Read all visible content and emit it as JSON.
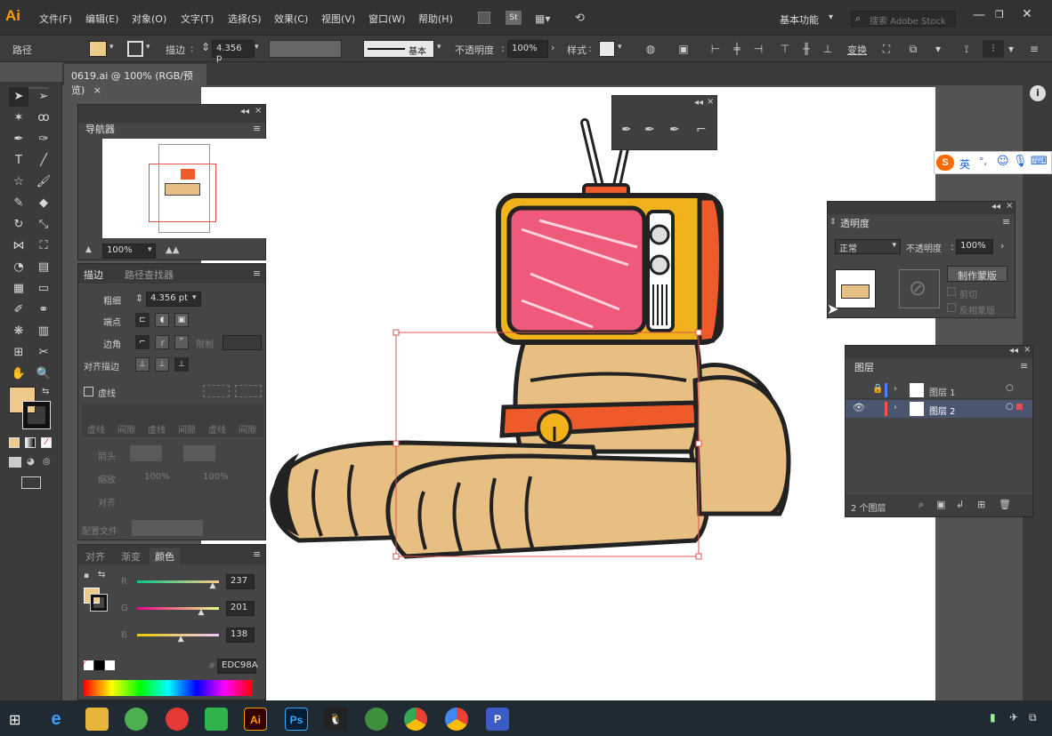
{
  "app": {
    "logo": "Ai",
    "menus": [
      "文件(F)",
      "编辑(E)",
      "对象(O)",
      "文字(T)",
      "选择(S)",
      "效果(C)",
      "视图(V)",
      "窗口(W)",
      "帮助(H)"
    ],
    "st_badge": "St",
    "workspace": "基本功能",
    "search_placeholder": "搜索 Adobe Stock"
  },
  "control_bar": {
    "path_label": "路径",
    "stroke_label": "描边",
    "stroke_value": "4.356 p",
    "profile_label": "基本",
    "opacity_label": "不透明度",
    "opacity_value": "100%",
    "style_label": "样式",
    "transform_label": "变换"
  },
  "document": {
    "tab_title": "0619.ai @ 100% (RGB/预览)",
    "close": "×"
  },
  "navigator": {
    "title": "导航器",
    "zoom": "100%"
  },
  "stroke_panel": {
    "tabs": [
      "描边",
      "路径查找器"
    ],
    "weight_label": "粗细",
    "weight_value": "4.356 pt",
    "cap_label": "端点",
    "corner_label": "边角",
    "limit_label": "限制",
    "align_label": "对齐描边",
    "dashed_label": "虚线",
    "dash_labels": [
      "虚线",
      "间隙",
      "虚线",
      "间隙",
      "虚线",
      "间隙"
    ],
    "arrow_label": "箭头",
    "scale_label": "缩放",
    "scale_a": "100%",
    "scale_b": "100%",
    "align_arrow_label": "对齐",
    "profile_label": "配置文件"
  },
  "color_panel": {
    "tabs": [
      "对齐",
      "渐变",
      "颜色"
    ],
    "r_label": "R",
    "g_label": "G",
    "b_label": "B",
    "r": 237,
    "g": 201,
    "b": 138,
    "hex_prefix": "#",
    "hex": "EDC98A",
    "fill_color": "#EDC98A"
  },
  "transparency_panel": {
    "title": "透明度",
    "blend_mode": "正常",
    "opacity_label": "不透明度",
    "opacity_value": "100%",
    "make_mask_label": "制作蒙版",
    "clip_label": "剪切",
    "invert_label": "反相蒙版"
  },
  "layers_panel": {
    "title": "图层",
    "layers": [
      {
        "name": "图层 1",
        "color": "#4f7fff",
        "locked": true,
        "visible": false
      },
      {
        "name": "图层 2",
        "color": "#ff4f4f",
        "locked": false,
        "visible": true
      }
    ],
    "count_label": "2 个图层"
  },
  "ime": {
    "label": "英"
  },
  "taskbar": {
    "apps": [
      "e",
      "Ai",
      "Ps",
      "P"
    ]
  }
}
